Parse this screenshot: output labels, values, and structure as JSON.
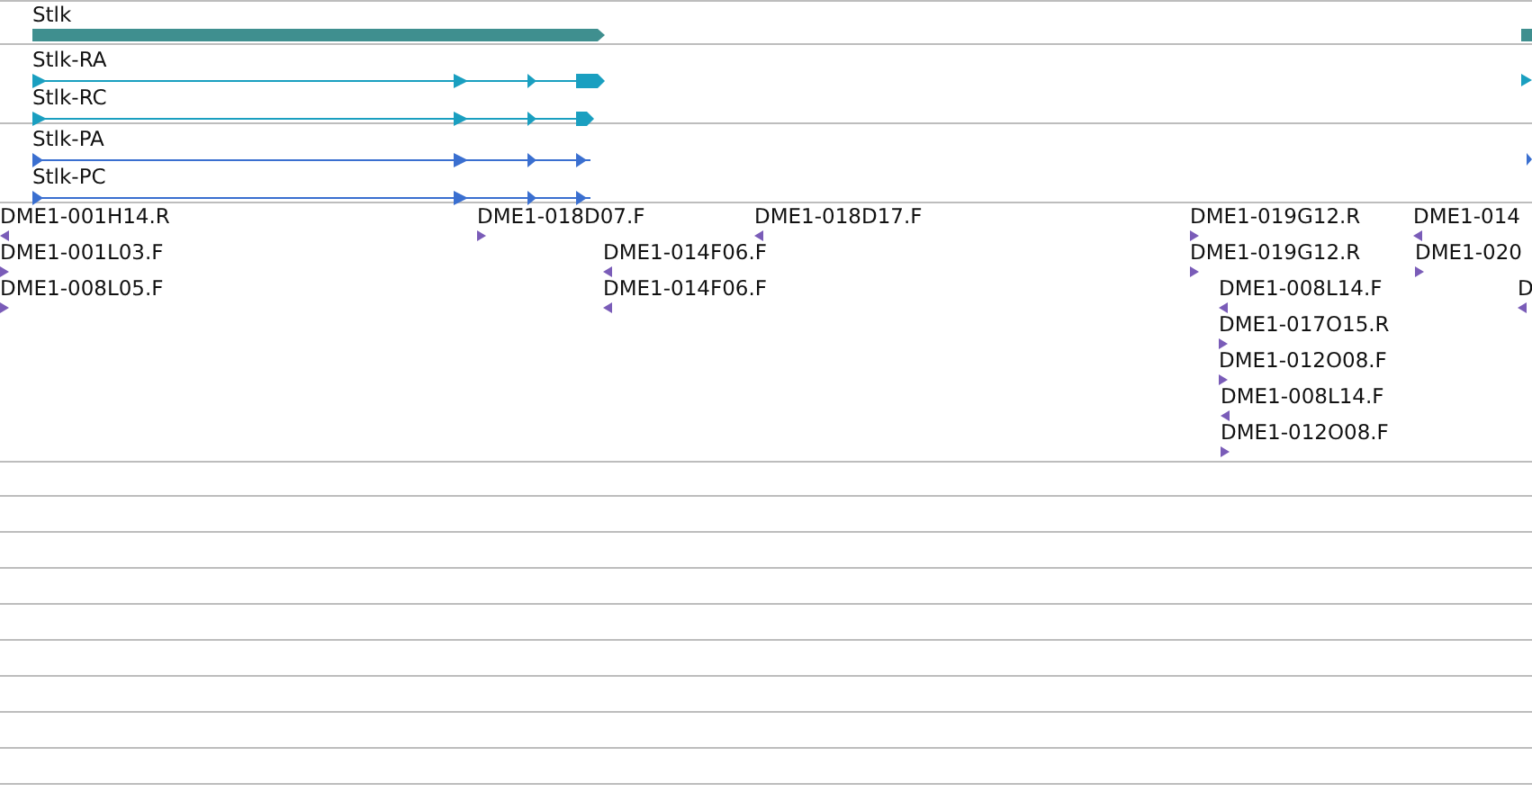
{
  "gene_track": {
    "features": [
      {
        "label": "Stlk",
        "reverse": false
      }
    ]
  },
  "transcript_track": {
    "features": [
      {
        "label": "Stlk-RA",
        "reverse": false
      },
      {
        "label": "Stlk-RC",
        "reverse": false
      }
    ]
  },
  "protein_track": {
    "features": [
      {
        "label": "Stlk-PA",
        "reverse": false
      },
      {
        "label": "Stlk-PC",
        "reverse": false
      }
    ]
  },
  "est_track": {
    "features": [
      {
        "label": "DME1-001H14.R",
        "reverse": true
      },
      {
        "label": "DME1-018D07.F",
        "reverse": false
      },
      {
        "label": "DME1-018D17.F",
        "reverse": true
      },
      {
        "label": "DME1-019G12.R",
        "reverse": false
      },
      {
        "label": "DME1-014",
        "reverse": true
      },
      {
        "label": "DME1-001L03.F",
        "reverse": false
      },
      {
        "label": "DME1-014F06.F",
        "reverse": true
      },
      {
        "label": "DME1-019G12.R",
        "reverse": false
      },
      {
        "label": "DME1-020",
        "reverse": false
      },
      {
        "label": "DME1-008L05.F",
        "reverse": false
      },
      {
        "label": "DME1-014F06.F",
        "reverse": true
      },
      {
        "label": "DME1-008L14.F",
        "reverse": true
      },
      {
        "label": "D",
        "reverse": true
      },
      {
        "label": "DME1-017O15.R",
        "reverse": false
      },
      {
        "label": "DME1-012O08.F",
        "reverse": false
      },
      {
        "label": "DME1-008L14.F",
        "reverse": true
      },
      {
        "label": "DME1-012O08.F",
        "reverse": false
      }
    ]
  }
}
